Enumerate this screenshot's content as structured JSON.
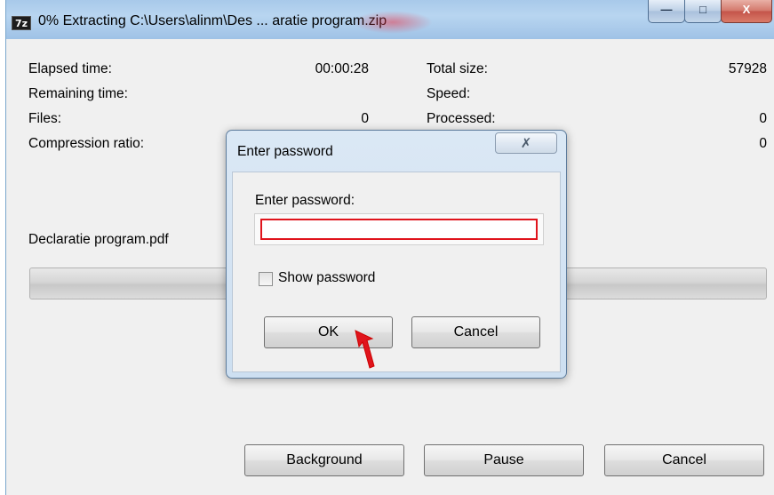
{
  "window": {
    "app_icon": "7z",
    "title": "0% Extracting C:\\Users\\alinm\\Des ... aratie program.zip",
    "min_symbol": "—",
    "max_symbol": "□",
    "close_symbol": "X"
  },
  "stats": {
    "elapsed_label": "Elapsed time:",
    "elapsed_value": "00:00:28",
    "remaining_label": "Remaining time:",
    "remaining_value": "",
    "files_label": "Files:",
    "files_value": "0",
    "compression_label": "Compression ratio:",
    "compression_value": "",
    "total_size_label": "Total size:",
    "total_size_value": "57928",
    "speed_label": "Speed:",
    "speed_value": "",
    "processed_label": "Processed:",
    "processed_value": "0",
    "compressed_value": "0"
  },
  "current_file": "Declaratie program.pdf",
  "progress": {
    "percent": 0
  },
  "buttons": {
    "background": "Background",
    "pause": "Pause",
    "cancel": "Cancel"
  },
  "dialog": {
    "title": "Enter password",
    "close_symbol": "✗",
    "prompt": "Enter password:",
    "password_value": "",
    "show_password_label": "Show password",
    "show_password_checked": false,
    "ok": "OK",
    "cancel": "Cancel"
  },
  "colors": {
    "titlebar": "#a8c9ea",
    "window_bg": "#f0f0f0",
    "input_border": "#e0141c",
    "annotation_arrow": "#e0141c"
  },
  "icons": {
    "app": "7zip-icon",
    "arrow": "red-pointer-arrow-icon"
  }
}
